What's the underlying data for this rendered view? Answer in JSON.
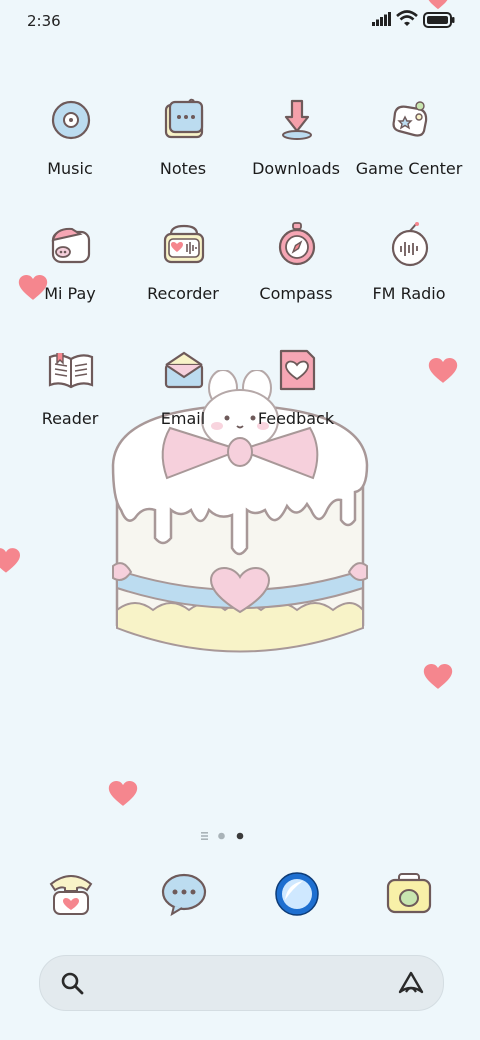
{
  "status_bar": {
    "time": "2:36",
    "icons": [
      "signal-icon",
      "wifi-icon",
      "battery-icon"
    ]
  },
  "apps": [
    {
      "label": "Music",
      "icon": "music-disc-icon"
    },
    {
      "label": "Notes",
      "icon": "notes-icon"
    },
    {
      "label": "Downloads",
      "icon": "download-arrow-icon"
    },
    {
      "label": "Game Center",
      "icon": "gamepad-icon"
    },
    {
      "label": "Mi Pay",
      "icon": "pig-wallet-icon"
    },
    {
      "label": "Recorder",
      "icon": "recorder-icon"
    },
    {
      "label": "Compass",
      "icon": "compass-icon"
    },
    {
      "label": "FM Radio",
      "icon": "radio-icon"
    },
    {
      "label": "Reader",
      "icon": "open-book-icon"
    },
    {
      "label": "Email",
      "icon": "envelope-icon"
    },
    {
      "label": "Feedback",
      "icon": "feedback-heart-icon"
    }
  ],
  "page_indicator": {
    "pages": 3,
    "current": 3
  },
  "dock": [
    {
      "name": "phone",
      "icon": "phone-icon"
    },
    {
      "name": "messaging",
      "icon": "chat-bubble-icon"
    },
    {
      "name": "browser",
      "icon": "browser-globe-icon"
    },
    {
      "name": "camera",
      "icon": "camera-icon"
    }
  ],
  "search": {
    "search_icon": "search-icon",
    "assistant_icon": "assistant-icon"
  },
  "colors": {
    "background": "#eef7fb",
    "heart": "#f5868e",
    "pink": "#f6d0dc",
    "blue": "#bcdcf0",
    "yellow": "#f8f3c8",
    "outline": "#6e5a5a"
  }
}
